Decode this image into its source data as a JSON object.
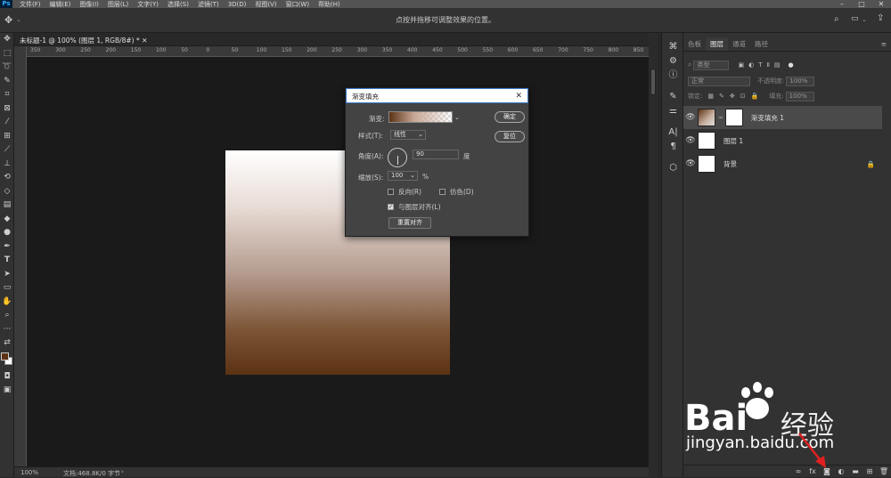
{
  "menubar": {
    "logo": "Ps",
    "items": [
      "文件(F)",
      "编辑(E)",
      "图像(I)",
      "图层(L)",
      "文字(Y)",
      "选择(S)",
      "滤镜(T)",
      "3D(D)",
      "视图(V)",
      "窗口(W)",
      "帮助(H)"
    ]
  },
  "options": {
    "hint": "点按并拖移可调整效果的位置。"
  },
  "document": {
    "tab_title": "未标题-1 @ 100% (图层 1, RGB/8#) *",
    "ruler_ticks": [
      "350",
      "300",
      "250",
      "200",
      "150",
      "100",
      "50",
      "0",
      "50",
      "100",
      "150",
      "200",
      "250",
      "300",
      "350",
      "400",
      "450",
      "500",
      "550",
      "600",
      "650",
      "700",
      "750",
      "800",
      "850"
    ]
  },
  "status": {
    "zoom": "100%",
    "doc_info": "文档:468.8K/0 字节"
  },
  "panel": {
    "tabs": [
      "色板",
      "图层",
      "通道",
      "路径"
    ],
    "active_tab": 1,
    "filter_kind": "类型",
    "blend_mode": "正常",
    "opacity_label": "不透明度:",
    "opacity_value": "100%",
    "lock_label": "锁定:",
    "fill_label": "填充:",
    "fill_value": "100%",
    "layers": [
      {
        "name": "渐变填充 1",
        "selected": true
      },
      {
        "name": "图层 1",
        "selected": false
      },
      {
        "name": "背景",
        "selected": false
      }
    ]
  },
  "dialog": {
    "title": "渐变填充",
    "gradient_label": "渐变:",
    "style_label": "样式(T):",
    "style_value": "线性",
    "angle_label": "角度(A):",
    "angle_value": "90",
    "angle_unit": "度",
    "scale_label": "缩放(S):",
    "scale_value": "100",
    "scale_unit": "%",
    "reverse_label": "反向(R)",
    "reverse_checked": false,
    "dither_label": "仿色(D)",
    "dither_checked": false,
    "align_label": "与图层对齐(L)",
    "align_checked": true,
    "reset_align_button": "重置对齐",
    "ok_button": "确定",
    "reset_button": "复位"
  },
  "watermark": {
    "brand": "Bai",
    "cn": "经验",
    "url": "jingyan.baidu.com"
  },
  "colors": {
    "foreground": "#5c3214",
    "background": "#ffffff",
    "arrow": "#e02020"
  }
}
